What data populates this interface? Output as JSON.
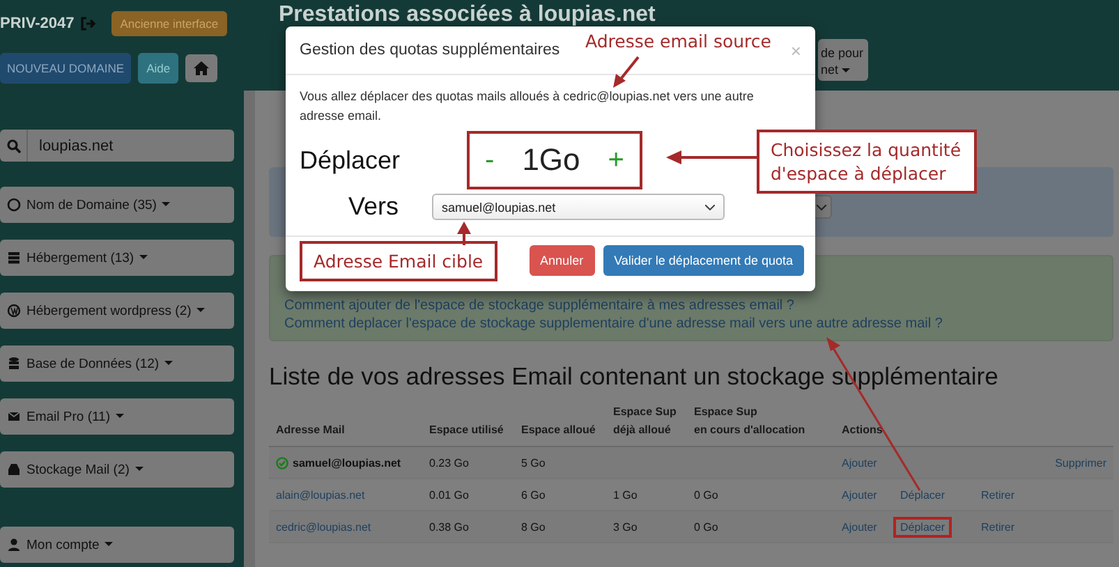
{
  "header": {
    "account": "PRIV-2047",
    "legacy_button": "Ancienne interface",
    "title": "Prestations associées à loupias.net",
    "partial_button": [
      "de pour",
      "net"
    ]
  },
  "sidebar": {
    "new_domain": "NOUVEAU DOMAINE",
    "help": "Aide",
    "search": {
      "value": "loupias.net"
    },
    "items": [
      {
        "label": "Nom de Domaine (35)",
        "kind": "globe"
      },
      {
        "label": "Hébergement (13)",
        "kind": "server"
      },
      {
        "label": "Hébergement wordpress (2)",
        "kind": "wordpress"
      },
      {
        "label": "Base de Données (12)",
        "kind": "database"
      },
      {
        "label": "Email Pro (11)",
        "kind": "mail"
      },
      {
        "label": "Stockage Mail (2)",
        "kind": "inbox"
      },
      {
        "label": "Mon compte",
        "kind": "user"
      }
    ]
  },
  "help": {
    "links": [
      "Comment ajouter de l'espace de stockage supplémentaire à mes adresses email ?",
      "Comment deplacer l'espace de stockage supplementaire d'une adresse mail vers une autre adresse mail ?"
    ]
  },
  "table": {
    "title": "Liste de vos adresses Email contenant un stockage supplémentaire",
    "columns": [
      "Adresse Mail",
      "Espace utilisé",
      "Espace alloué",
      "Espace Sup\ndéjà alloué",
      "Espace Sup\nen cours d'allocation",
      "Actions"
    ],
    "rows": [
      {
        "verified": true,
        "cells": [
          "samuel@loupias.net",
          "0.23 Go",
          "5 Go"
        ],
        "actions": [
          {
            "label": "Ajouter",
            "kind": "add",
            "highlighted": false
          },
          {
            "label": "Supprimer",
            "kind": "delete",
            "highlighted": false
          }
        ]
      },
      {
        "verified": false,
        "cells": [
          "alain@loupias.net",
          "0.01 Go",
          "6 Go",
          "1 Go",
          "0 Go"
        ],
        "actions": [
          {
            "label": "Ajouter",
            "kind": "add",
            "highlighted": false
          },
          {
            "label": "Déplacer",
            "kind": "move",
            "highlighted": false
          },
          {
            "label": "Retirer",
            "kind": "remove",
            "highlighted": false
          }
        ]
      },
      {
        "verified": false,
        "cells": [
          "cedric@loupias.net",
          "0.38 Go",
          "8 Go",
          "3 Go",
          "0 Go"
        ],
        "actions": [
          {
            "label": "Ajouter",
            "kind": "add",
            "highlighted": false
          },
          {
            "label": "Déplacer",
            "kind": "move",
            "highlighted": true
          },
          {
            "label": "Retirer",
            "kind": "remove",
            "highlighted": false
          }
        ]
      }
    ]
  },
  "modal": {
    "title": "Gestion des quotas supplémentaires",
    "close": "×",
    "message": "Vous allez déplacer des quotas mails alloués à cedric@loupias.net vers une autre adresse email.",
    "move_label": "Déplacer",
    "decrement": "-",
    "quantity": "1Go",
    "increment": "+",
    "to_label": "Vers",
    "target": "samuel@loupias.net",
    "buttons": [
      {
        "label": "Annuler",
        "kind": "danger"
      },
      {
        "label": "Valider le déplacement de quota",
        "kind": "primary"
      }
    ]
  },
  "annotations": [
    {
      "text": "Adresse email source",
      "boxed": false
    },
    {
      "text": "Choisissez la quantité d'espace à déplacer",
      "boxed": true
    },
    {
      "text": "Adresse Email cible",
      "boxed": true
    }
  ]
}
